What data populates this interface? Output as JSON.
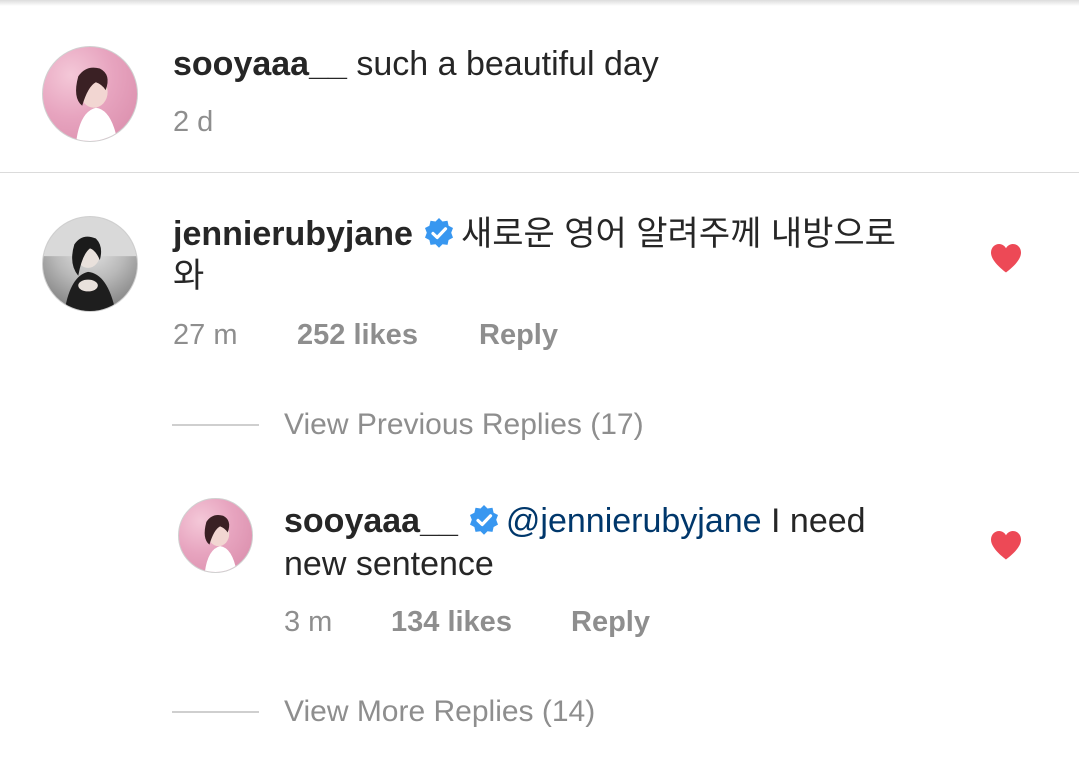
{
  "caption": {
    "username": "sooyaaa__",
    "text": "such a beautiful day",
    "time": "2 d"
  },
  "comment": {
    "username": "jennierubyjane",
    "verified": true,
    "text_line1": "새로운 영어 알려주께 내방으로",
    "text_line2": "와",
    "time": "27 m",
    "likes": "252 likes",
    "reply": "Reply",
    "liked": true
  },
  "view_previous": "View Previous Replies (17)",
  "reply": {
    "username": "sooyaaa__",
    "verified": true,
    "mention": "@jennierubyjane",
    "text_line1": " I need",
    "text_line2": "new sentence",
    "time": "3 m",
    "likes": "134 likes",
    "reply": "Reply",
    "liked": true
  },
  "view_more": "View More Replies (14)",
  "colors": {
    "heart": "#ed4956",
    "verified": "#3897f0",
    "mention": "#00376b",
    "secondary_text": "#8e8e8e"
  }
}
